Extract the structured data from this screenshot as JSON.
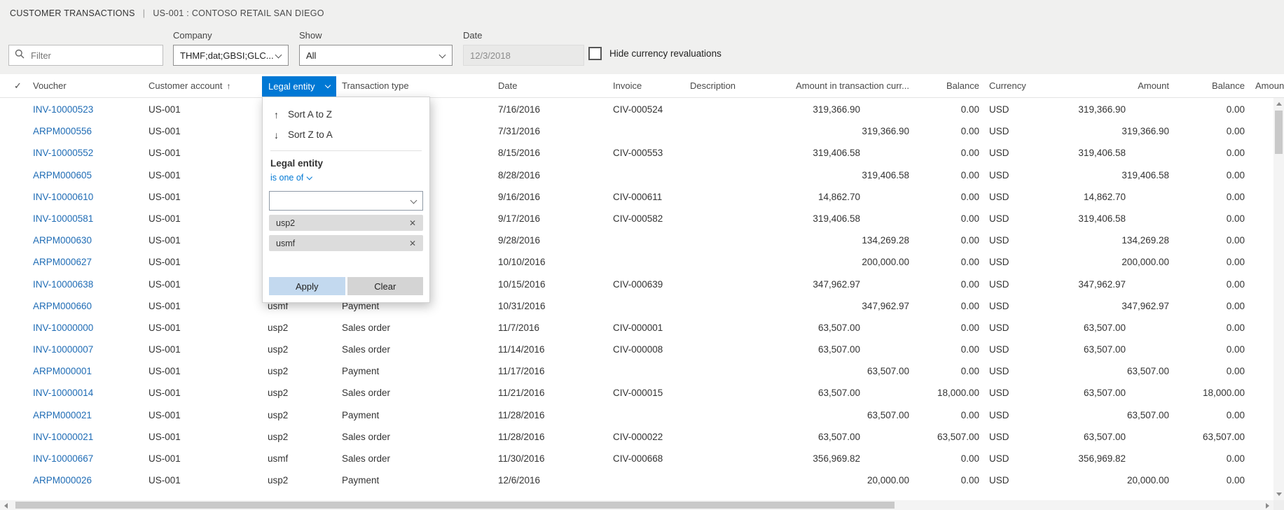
{
  "titlebar": {
    "title": "CUSTOMER TRANSACTIONS",
    "separator": "|",
    "subtitle": "US-001 : CONTOSO RETAIL SAN DIEGO"
  },
  "toolbar": {
    "filter": {
      "placeholder": "Filter"
    },
    "company": {
      "label": "Company",
      "value": "THMF;dat;GBSI;GLC..."
    },
    "show": {
      "label": "Show",
      "value": "All"
    },
    "date": {
      "label": "Date",
      "value": "12/3/2018"
    },
    "hide_revaluations": {
      "label": "Hide currency revaluations",
      "checked": false
    }
  },
  "grid": {
    "select_all_glyph": "✓",
    "columns": {
      "voucher": "Voucher",
      "customer_account": "Customer account",
      "sort_indicator": "↑",
      "legal_entity": "Legal entity",
      "transaction_type": "Transaction type",
      "date": "Date",
      "invoice": "Invoice",
      "description": "Description",
      "amount_txn": "Amount in transaction curr...",
      "balance1": "Balance",
      "currency": "Currency",
      "amount": "Amount",
      "balance2": "Balance",
      "amount2": "Amount"
    },
    "rows": [
      {
        "voucher": "INV-10000523",
        "account": "US-001",
        "legal_entity": "",
        "txn_type": "",
        "date": "7/16/2016",
        "invoice": "CIV-000524",
        "description": "",
        "amount_txn": "319,366.90",
        "balance1": "0.00",
        "currency": "USD",
        "amount": "319,366.90",
        "balance2": "0.00",
        "credit": false
      },
      {
        "voucher": "ARPM000556",
        "account": "US-001",
        "legal_entity": "",
        "txn_type": "",
        "date": "7/31/2016",
        "invoice": "",
        "description": "",
        "amount_txn": "319,366.90",
        "balance1": "0.00",
        "currency": "USD",
        "amount": "319,366.90",
        "balance2": "0.00",
        "credit": true
      },
      {
        "voucher": "INV-10000552",
        "account": "US-001",
        "legal_entity": "",
        "txn_type": "",
        "date": "8/15/2016",
        "invoice": "CIV-000553",
        "description": "",
        "amount_txn": "319,406.58",
        "balance1": "0.00",
        "currency": "USD",
        "amount": "319,406.58",
        "balance2": "0.00",
        "credit": false
      },
      {
        "voucher": "ARPM000605",
        "account": "US-001",
        "legal_entity": "",
        "txn_type": "",
        "date": "8/28/2016",
        "invoice": "",
        "description": "",
        "amount_txn": "319,406.58",
        "balance1": "0.00",
        "currency": "USD",
        "amount": "319,406.58",
        "balance2": "0.00",
        "credit": true
      },
      {
        "voucher": "INV-10000610",
        "account": "US-001",
        "legal_entity": "",
        "txn_type": "",
        "date": "9/16/2016",
        "invoice": "CIV-000611",
        "description": "",
        "amount_txn": "14,862.70",
        "balance1": "0.00",
        "currency": "USD",
        "amount": "14,862.70",
        "balance2": "0.00",
        "credit": false
      },
      {
        "voucher": "INV-10000581",
        "account": "US-001",
        "legal_entity": "",
        "txn_type": "",
        "date": "9/17/2016",
        "invoice": "CIV-000582",
        "description": "",
        "amount_txn": "319,406.58",
        "balance1": "0.00",
        "currency": "USD",
        "amount": "319,406.58",
        "balance2": "0.00",
        "credit": false
      },
      {
        "voucher": "ARPM000630",
        "account": "US-001",
        "legal_entity": "",
        "txn_type": "",
        "date": "9/28/2016",
        "invoice": "",
        "description": "",
        "amount_txn": "134,269.28",
        "balance1": "0.00",
        "currency": "USD",
        "amount": "134,269.28",
        "balance2": "0.00",
        "credit": true
      },
      {
        "voucher": "ARPM000627",
        "account": "US-001",
        "legal_entity": "",
        "txn_type": "",
        "date": "10/10/2016",
        "invoice": "",
        "description": "",
        "amount_txn": "200,000.00",
        "balance1": "0.00",
        "currency": "USD",
        "amount": "200,000.00",
        "balance2": "0.00",
        "credit": true
      },
      {
        "voucher": "INV-10000638",
        "account": "US-001",
        "legal_entity": "",
        "txn_type": "",
        "date": "10/15/2016",
        "invoice": "CIV-000639",
        "description": "",
        "amount_txn": "347,962.97",
        "balance1": "0.00",
        "currency": "USD",
        "amount": "347,962.97",
        "balance2": "0.00",
        "credit": false
      },
      {
        "voucher": "ARPM000660",
        "account": "US-001",
        "legal_entity": "usmf",
        "txn_type": "Payment",
        "date": "10/31/2016",
        "invoice": "",
        "description": "",
        "amount_txn": "347,962.97",
        "balance1": "0.00",
        "currency": "USD",
        "amount": "347,962.97",
        "balance2": "0.00",
        "credit": true
      },
      {
        "voucher": "INV-10000000",
        "account": "US-001",
        "legal_entity": "usp2",
        "txn_type": "Sales order",
        "date": "11/7/2016",
        "invoice": "CIV-000001",
        "description": "",
        "amount_txn": "63,507.00",
        "balance1": "0.00",
        "currency": "USD",
        "amount": "63,507.00",
        "balance2": "0.00",
        "credit": false
      },
      {
        "voucher": "INV-10000007",
        "account": "US-001",
        "legal_entity": "usp2",
        "txn_type": "Sales order",
        "date": "11/14/2016",
        "invoice": "CIV-000008",
        "description": "",
        "amount_txn": "63,507.00",
        "balance1": "0.00",
        "currency": "USD",
        "amount": "63,507.00",
        "balance2": "0.00",
        "credit": false
      },
      {
        "voucher": "ARPM000001",
        "account": "US-001",
        "legal_entity": "usp2",
        "txn_type": "Payment",
        "date": "11/17/2016",
        "invoice": "",
        "description": "",
        "amount_txn": "63,507.00",
        "balance1": "0.00",
        "currency": "USD",
        "amount": "63,507.00",
        "balance2": "0.00",
        "credit": true
      },
      {
        "voucher": "INV-10000014",
        "account": "US-001",
        "legal_entity": "usp2",
        "txn_type": "Sales order",
        "date": "11/21/2016",
        "invoice": "CIV-000015",
        "description": "",
        "amount_txn": "63,507.00",
        "balance1": "18,000.00",
        "currency": "USD",
        "amount": "63,507.00",
        "balance2": "18,000.00",
        "credit": false
      },
      {
        "voucher": "ARPM000021",
        "account": "US-001",
        "legal_entity": "usp2",
        "txn_type": "Payment",
        "date": "11/28/2016",
        "invoice": "",
        "description": "",
        "amount_txn": "63,507.00",
        "balance1": "0.00",
        "currency": "USD",
        "amount": "63,507.00",
        "balance2": "0.00",
        "credit": true
      },
      {
        "voucher": "INV-10000021",
        "account": "US-001",
        "legal_entity": "usp2",
        "txn_type": "Sales order",
        "date": "11/28/2016",
        "invoice": "CIV-000022",
        "description": "",
        "amount_txn": "63,507.00",
        "balance1": "63,507.00",
        "currency": "USD",
        "amount": "63,507.00",
        "balance2": "63,507.00",
        "credit": false
      },
      {
        "voucher": "INV-10000667",
        "account": "US-001",
        "legal_entity": "usmf",
        "txn_type": "Sales order",
        "date": "11/30/2016",
        "invoice": "CIV-000668",
        "description": "",
        "amount_txn": "356,969.82",
        "balance1": "0.00",
        "currency": "USD",
        "amount": "356,969.82",
        "balance2": "0.00",
        "credit": false
      },
      {
        "voucher": "ARPM000026",
        "account": "US-001",
        "legal_entity": "usp2",
        "txn_type": "Payment",
        "date": "12/6/2016",
        "invoice": "",
        "description": "",
        "amount_txn": "20,000.00",
        "balance1": "0.00",
        "currency": "USD",
        "amount": "20,000.00",
        "balance2": "0.00",
        "credit": true
      }
    ]
  },
  "filter_flyout": {
    "sort_asc": {
      "icon": "↑",
      "label": "Sort A to Z"
    },
    "sort_desc": {
      "icon": "↓",
      "label": "Sort Z to A"
    },
    "field_label": "Legal entity",
    "operator_label": "is one of",
    "input_value": "",
    "tags": [
      {
        "label": "usp2",
        "remove_glyph": "✕"
      },
      {
        "label": "usmf",
        "remove_glyph": "✕"
      }
    ],
    "apply_label": "Apply",
    "clear_label": "Clear"
  },
  "colors": {
    "accent": "#0078d4",
    "link": "#1f6cb5"
  }
}
